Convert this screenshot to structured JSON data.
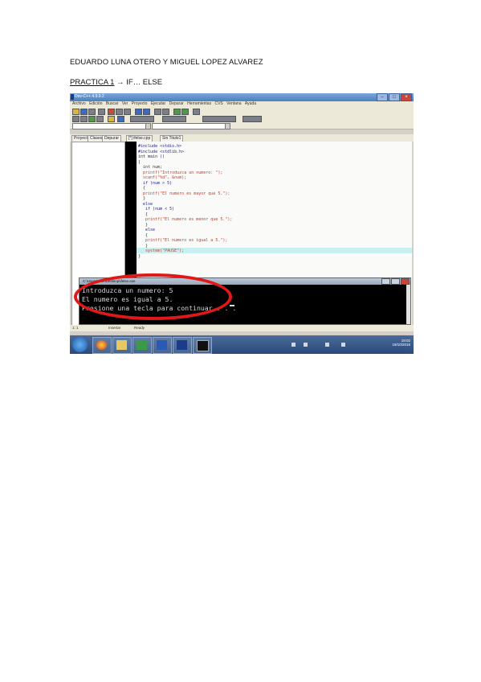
{
  "document": {
    "authors": "EDUARDO LUNA OTERO Y MIGUEL LOPEZ ALVAREZ",
    "practice_label": "PRACTICA 1",
    "practice_arrow": " → IF… ELSE"
  },
  "ide": {
    "title": "Dev-C++ 4.9.9.2",
    "menu": [
      "Archivo",
      "Edición",
      "Buscar",
      "Ver",
      "Proyecto",
      "Ejecutar",
      "Depurar",
      "Herramientas",
      "CVS",
      "Ventana",
      "Ayuda"
    ],
    "tabs": [
      "Proyecto",
      "Clases",
      "Depurar"
    ],
    "file_tabs": [
      "[*] ifelse.cpp",
      "Sin Titulo1"
    ],
    "code": [
      {
        "text": "#include <stdio.h>",
        "color": "blue"
      },
      {
        "text": "#include <stdlib.h>",
        "color": "blue"
      },
      {
        "text": "int main ()",
        "color": "blue"
      },
      {
        "text": "{",
        "color": "dark"
      },
      {
        "text": "  int num;",
        "color": "dark"
      },
      {
        "text": "  printf(\"Introduzca un numero: \");",
        "color": "red"
      },
      {
        "text": "  scanf(\"%d\", &num);",
        "color": "red"
      },
      {
        "text": "  if (num > 5)",
        "color": "blue"
      },
      {
        "text": "  {",
        "color": "dark"
      },
      {
        "text": "  printf(\"El numero es mayor que 5.\");",
        "color": "red"
      },
      {
        "text": "  }",
        "color": "dark"
      },
      {
        "text": "  else",
        "color": "blue"
      },
      {
        "text": "   if (num < 5)",
        "color": "blue"
      },
      {
        "text": "   {",
        "color": "dark"
      },
      {
        "text": "   printf(\"El numero es menor que 5.\");",
        "color": "red"
      },
      {
        "text": "   }",
        "color": "dark"
      },
      {
        "text": "   else",
        "color": "blue"
      },
      {
        "text": "   {",
        "color": "dark"
      },
      {
        "text": "   printf(\"El numero es igual a 5.\");",
        "color": "red"
      },
      {
        "text": "   }",
        "color": "dark"
      },
      {
        "text": "   system(\"PAUSE\");",
        "color": "red"
      },
      {
        "text": "}",
        "color": "dark"
      }
    ],
    "status": [
      "1: 1",
      "Insertar",
      "Ready"
    ]
  },
  "console": {
    "title": "C:\\Users\\user\\Desktop\\ifelse.exe",
    "lines": [
      "Introduzca un numero: 5",
      "El numero es igual a 5.",
      "Presione una tecla para continuar . . ."
    ]
  },
  "taskbar": {
    "time": "19:02",
    "date": "19/10/2016"
  },
  "colors": {
    "ring": "#e01818",
    "console_bg": "#000000",
    "highlight": "#c8f0f0"
  }
}
